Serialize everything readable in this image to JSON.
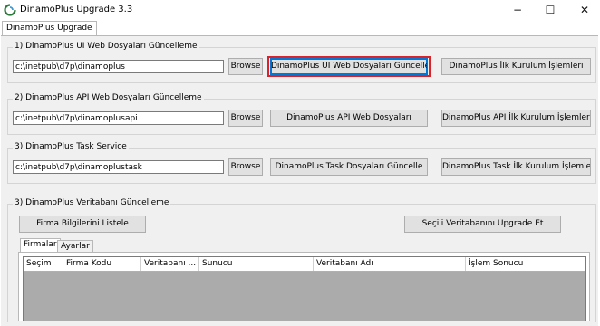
{
  "window": {
    "title": "DinamoPlus Upgrade 3.3",
    "minimize": "−",
    "maximize": "☐",
    "close": "✕"
  },
  "main_tab": "DinamoPlus Upgrade",
  "sections": [
    {
      "label": "1) DinamoPlus UI Web Dosyaları Güncelleme",
      "path": "c:\\inetpub\\d7p\\dinamoplus",
      "browse": "Browse",
      "update_button": "DinamoPlus UI Web Dosyaları Güncelle",
      "setup_button": "DinamoPlus İlk Kurulum İşlemleri"
    },
    {
      "label": "2) DinamoPlus API Web Dosyaları Güncelleme",
      "path": "c:\\inetpub\\d7p\\dinamoplusapi",
      "browse": "Browse",
      "update_button": "DinamoPlus API Web Dosyaları",
      "setup_button": "DinamoPlus API İlk Kurulum İşlemleri"
    },
    {
      "label": "3) DinamoPlus Task Service",
      "path": "c:\\inetpub\\d7p\\dinamoplustask",
      "browse": "Browse",
      "update_button": "DinamoPlus Task Dosyaları Güncelle",
      "setup_button": "DinamoPlus Task İlk Kurulum İşlemleri"
    }
  ],
  "db_section": {
    "label": "3) DinamoPlus Veritabanı Güncelleme",
    "list_button": "Firma Bilgilerini Listele",
    "upgrade_button": "Seçili Veritabanını Upgrade Et",
    "tabs": [
      "Firmalar",
      "Ayarlar"
    ],
    "columns": [
      "Seçim",
      "Firma Kodu",
      "Veritabanı ...",
      "Sunucu",
      "Veritabanı Adı",
      "İşlem Sonucu"
    ]
  },
  "colors": {
    "highlight_ring": "#d9232a",
    "focus_border": "#0078d7"
  }
}
